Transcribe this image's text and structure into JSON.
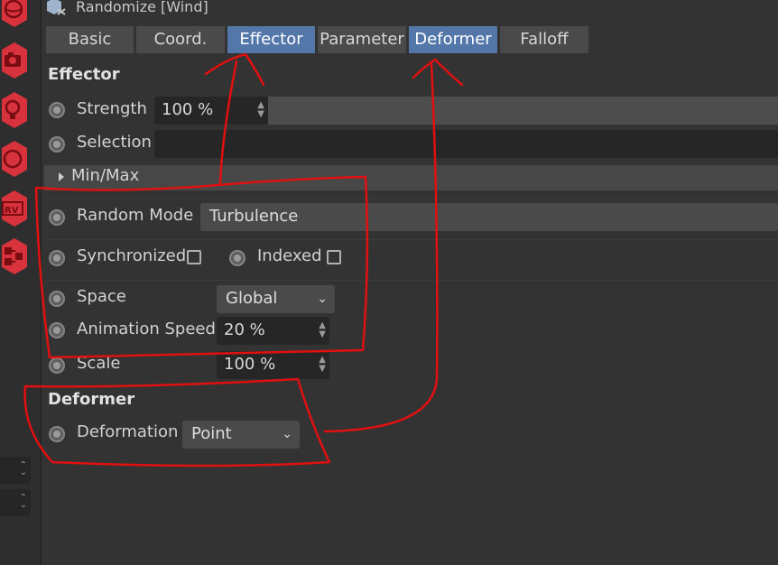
{
  "header": {
    "title": "Randomize [Wind]",
    "icon": "randomize-effector-icon"
  },
  "tabs": [
    {
      "label": "Basic",
      "active": false
    },
    {
      "label": "Coord.",
      "active": false
    },
    {
      "label": "Effector",
      "active": true
    },
    {
      "label": "Parameter",
      "active": false
    },
    {
      "label": "Deformer",
      "active": true
    },
    {
      "label": "Falloff",
      "active": false
    }
  ],
  "effector": {
    "title": "Effector",
    "strength": {
      "label": "Strength",
      "value": "100 %"
    },
    "selection": {
      "label": "Selection",
      "value": ""
    },
    "minmax": {
      "label": "Min/Max"
    }
  },
  "params": {
    "random_mode": {
      "label": "Random Mode",
      "value": "Turbulence"
    },
    "synchronized": {
      "label": "Synchronized",
      "checked": false
    },
    "indexed": {
      "label": "Indexed",
      "checked": false
    },
    "space": {
      "label": "Space",
      "value": "Global"
    },
    "animation_speed": {
      "label": "Animation Speed",
      "value": "20 %"
    },
    "scale": {
      "label": "Scale",
      "value": "100 %"
    }
  },
  "deformer": {
    "title": "Deformer",
    "deformation": {
      "label": "Deformation",
      "value": "Point"
    }
  },
  "colors": {
    "background": "#333333",
    "active_tab": "#5377a8",
    "annotation": "#e01010"
  }
}
